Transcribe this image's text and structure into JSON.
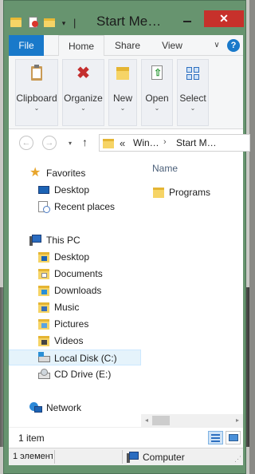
{
  "window": {
    "title": "Start Me…",
    "close_glyph": "✕"
  },
  "quick_access": {
    "icons": [
      "folder-icon",
      "properties-icon",
      "new-folder-icon"
    ],
    "dropdown_glyph": "▾",
    "separator_glyph": "|"
  },
  "ribbon": {
    "tabs": [
      {
        "label": "File",
        "active": false
      },
      {
        "label": "Home",
        "active": true
      },
      {
        "label": "Share",
        "active": false
      },
      {
        "label": "View",
        "active": false
      }
    ],
    "help_glyph": "?",
    "collapse_glyph": "∨",
    "groups": [
      {
        "label": "Clipboard",
        "icon": "clipboard-icon"
      },
      {
        "label": "Organize",
        "icon": "organize-icon"
      },
      {
        "label": "New",
        "icon": "new-folder-icon"
      },
      {
        "label": "Open",
        "icon": "open-icon"
      },
      {
        "label": "Select",
        "icon": "select-icon"
      }
    ],
    "group_chevron": "⌄",
    "organize_glyph": "✖"
  },
  "navigation": {
    "back_glyph": "←",
    "forward_glyph": "→",
    "recent_glyph": "▾",
    "up_glyph": "↑",
    "address": {
      "overflow": "«",
      "crumbs": [
        "Win…",
        "Start M…"
      ],
      "separator": "›"
    }
  },
  "tree": {
    "favorites": {
      "label": "Favorites",
      "items": [
        {
          "label": "Desktop",
          "icon": "desktop-icon"
        },
        {
          "label": "Recent places",
          "icon": "recent-places-icon"
        }
      ]
    },
    "this_pc": {
      "label": "This PC",
      "items": [
        {
          "label": "Desktop",
          "icon": "desktop-folder-icon"
        },
        {
          "label": "Documents",
          "icon": "documents-folder-icon"
        },
        {
          "label": "Downloads",
          "icon": "downloads-folder-icon"
        },
        {
          "label": "Music",
          "icon": "music-folder-icon"
        },
        {
          "label": "Pictures",
          "icon": "pictures-folder-icon"
        },
        {
          "label": "Videos",
          "icon": "videos-folder-icon"
        },
        {
          "label": "Local Disk (C:)",
          "icon": "local-disk-icon",
          "selected": true
        },
        {
          "label": "CD Drive (E:)",
          "icon": "cd-drive-icon"
        }
      ]
    },
    "network": {
      "label": "Network",
      "icon": "network-icon"
    }
  },
  "file_list": {
    "column_header": "Name",
    "items": [
      {
        "label": "Programs",
        "icon": "folder-icon"
      }
    ]
  },
  "status": {
    "item_count": "1 item",
    "views": [
      "details-view-icon",
      "large-icons-view-icon"
    ]
  },
  "statusbar": {
    "left_text": "1 элемент",
    "location": "Computer",
    "grip_glyph": "⋰"
  },
  "scrollbar": {
    "left_glyph": "◂",
    "right_glyph": "▸"
  },
  "colors": {
    "window_frame": "#67946f",
    "file_tab": "#1979ca",
    "close_button": "#c7312b",
    "selection": "#e5f3fb",
    "folder": "#f6d466"
  }
}
